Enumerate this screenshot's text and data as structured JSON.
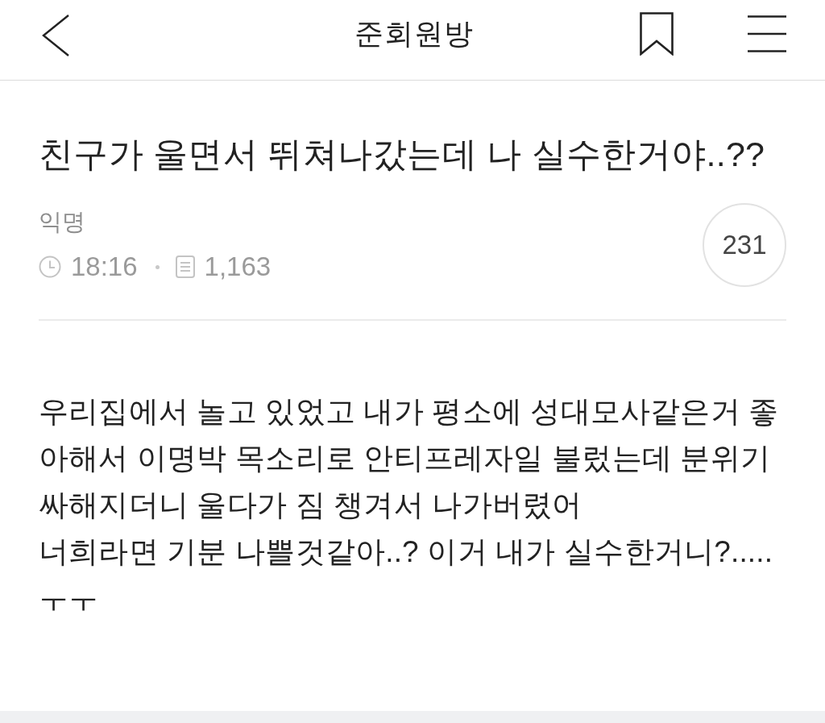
{
  "header": {
    "title": "준회원방"
  },
  "post": {
    "title": "친구가 울면서 뛰쳐나갔는데 나 실수한거야..??",
    "author": "익명",
    "time": "18:16",
    "views": "1,163",
    "comment_count": "231",
    "body": [
      "우리집에서 놀고 있었고 내가 평소에 성대모사같은거 좋아해서 이명박 목소리로 안티프레자일 불렀는데 분위기 싸해지더니 울다가 짐 챙겨서 나가버렸어",
      "너희라면 기분 나쁠것같아..? 이거 내가 실수한거니?.....",
      "ㅜㅜ"
    ]
  }
}
